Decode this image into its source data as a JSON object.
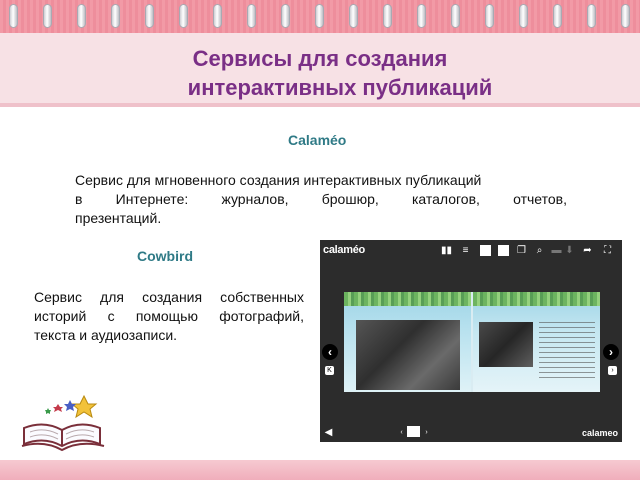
{
  "slide": {
    "title_line1": "Сервисы для создания",
    "title_line2": "интерактивных публикаций"
  },
  "sections": [
    {
      "heading": "Calaméo",
      "text_line1": "Сервис для мгновенного создания интерактивных публикаций",
      "text_line2": "в Интернете: журналов, брошюр, каталогов, отчетов,",
      "text_line3": "презентаций."
    },
    {
      "heading": "Cowbird",
      "text_line1": "Сервис для создания собственных",
      "text_line2": "историй с помощью фотографий,",
      "text_line3": "текста и аудиозаписи."
    }
  ],
  "viewer": {
    "logo": "calaméo",
    "logo_small": "calameo",
    "icons": [
      "book-icon",
      "list-icon",
      "folder-icon",
      "card-icon",
      "document-icon",
      "zoom-icon",
      "print-icon",
      "download-icon",
      "share-icon",
      "fullscreen-icon",
      "prev-icon",
      "next-icon",
      "first-page-icon",
      "sound-icon"
    ]
  },
  "colors": {
    "title": "#7a2f86",
    "heading": "#2f7a86",
    "band": "#f29aa6"
  }
}
